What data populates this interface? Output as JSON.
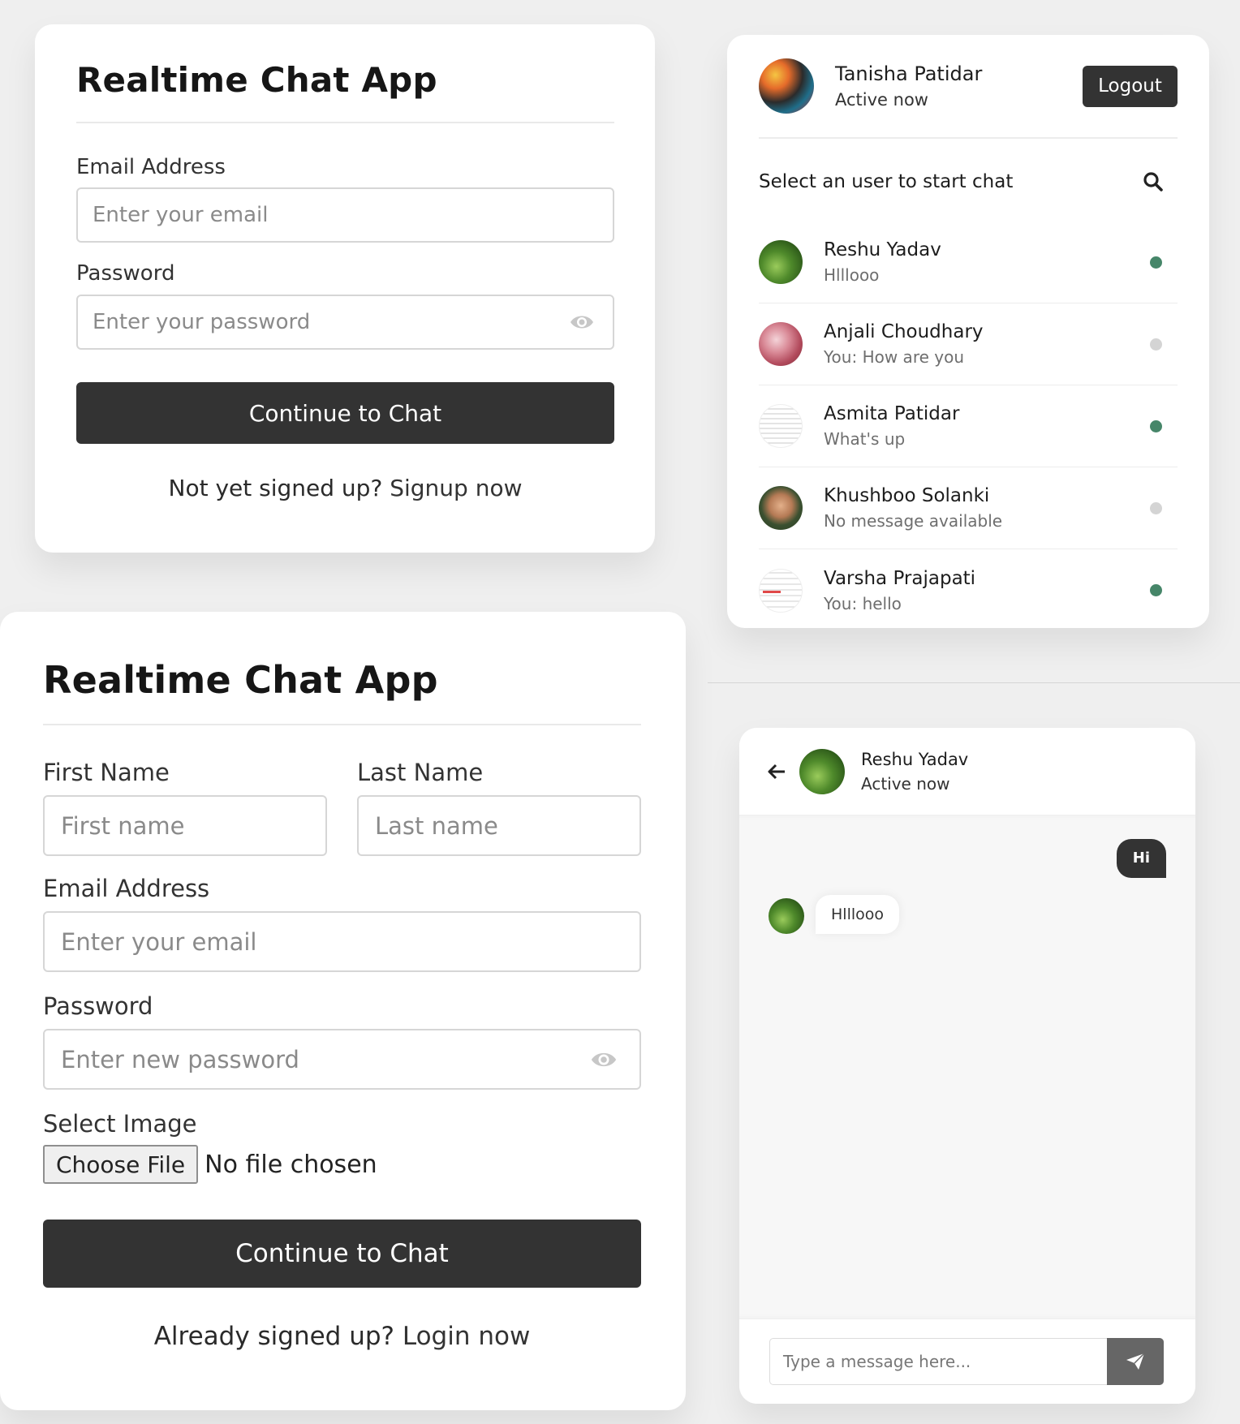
{
  "login": {
    "title": "Realtime Chat App",
    "email_label": "Email Address",
    "email_placeholder": "Enter your email",
    "password_label": "Password",
    "password_placeholder": "Enter your password",
    "submit_label": "Continue to Chat",
    "footer_text": "Not yet signed up?",
    "footer_link": "Signup now"
  },
  "signup": {
    "title": "Realtime Chat App",
    "first_name_label": "First Name",
    "first_name_placeholder": "First name",
    "last_name_label": "Last Name",
    "last_name_placeholder": "Last name",
    "email_label": "Email Address",
    "email_placeholder": "Enter your email",
    "password_label": "Password",
    "password_placeholder": "Enter new password",
    "image_label": "Select Image",
    "choose_file_label": "Choose File",
    "file_status": "No file chosen",
    "submit_label": "Continue to Chat",
    "footer_text": "Already signed up?",
    "footer_link": "Login now"
  },
  "users": {
    "current_user": {
      "name": "Tanisha Patidar",
      "status": "Active now",
      "avatar": "tree-avatar"
    },
    "logout_label": "Logout",
    "search_prompt": "Select an user to start chat",
    "search_icon": "search-icon",
    "list": [
      {
        "name": "Reshu Yadav",
        "message": "Hlllooo",
        "online": true
      },
      {
        "name": "Anjali Choudhary",
        "message": "You: How are you",
        "online": false
      },
      {
        "name": "Asmita Patidar",
        "message": "What's up",
        "online": true
      },
      {
        "name": "Khushboo Solanki",
        "message": "No message available",
        "online": false
      },
      {
        "name": "Varsha Prajapati",
        "message": "You: hello",
        "online": true
      }
    ],
    "online_color": "#468669",
    "offline_color": "#d4d4d4"
  },
  "chat": {
    "back_icon": "arrow-left-icon",
    "contact": {
      "name": "Reshu Yadav",
      "status": "Active now"
    },
    "messages": [
      {
        "direction": "outgoing",
        "text": "Hi"
      },
      {
        "direction": "incoming",
        "text": "Hlllooo"
      }
    ],
    "input_placeholder": "Type a message here...",
    "send_icon": "paper-plane-icon"
  },
  "colors": {
    "dark_button": "#333333",
    "page_background": "#efefef"
  }
}
